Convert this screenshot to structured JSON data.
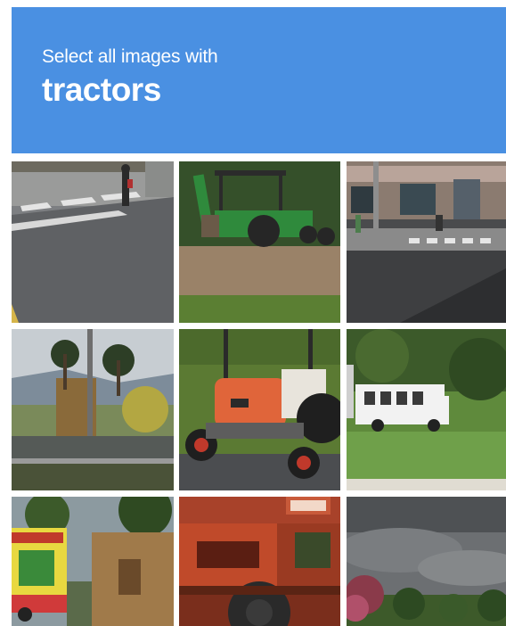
{
  "challenge": {
    "instruction": "Select all images with",
    "target": "tractors"
  },
  "colors": {
    "header_bg": "#4a90e2",
    "header_text": "#ffffff"
  },
  "tiles": [
    {
      "id": 1,
      "icon": "street-crosswalk-image"
    },
    {
      "id": 2,
      "icon": "green-tractor-image"
    },
    {
      "id": 3,
      "icon": "storefront-crosswalk-image"
    },
    {
      "id": 4,
      "icon": "palm-trees-gate-image"
    },
    {
      "id": 5,
      "icon": "orange-tractor-image"
    },
    {
      "id": 6,
      "icon": "white-bus-image"
    },
    {
      "id": 7,
      "icon": "truck-billboard-image"
    },
    {
      "id": 8,
      "icon": "red-machinery-image"
    },
    {
      "id": 9,
      "icon": "cloudy-sky-image"
    }
  ]
}
